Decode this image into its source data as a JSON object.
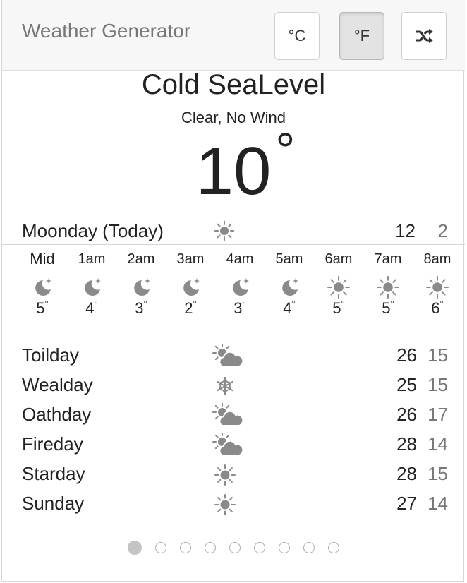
{
  "header": {
    "title": "Weather Generator",
    "celsius_label": "°C",
    "fahrenheit_label": "°F",
    "shuffle_icon": "shuffle-icon"
  },
  "current": {
    "location": "Cold SeaLevel",
    "conditions": "Clear, No Wind",
    "temperature": "10",
    "degree_symbol": "°"
  },
  "today": {
    "label": "Moonday (Today)",
    "icon": "sun-icon",
    "high": "12",
    "low": "2"
  },
  "hourly": [
    {
      "time": "Mid",
      "icon": "moon-icon",
      "temp": "5"
    },
    {
      "time": "1am",
      "icon": "moon-icon",
      "temp": "4"
    },
    {
      "time": "2am",
      "icon": "moon-icon",
      "temp": "3"
    },
    {
      "time": "3am",
      "icon": "moon-icon",
      "temp": "2"
    },
    {
      "time": "4am",
      "icon": "moon-icon",
      "temp": "3"
    },
    {
      "time": "5am",
      "icon": "moon-icon",
      "temp": "4"
    },
    {
      "time": "6am",
      "icon": "sun-icon",
      "temp": "5"
    },
    {
      "time": "7am",
      "icon": "sun-icon",
      "temp": "5"
    },
    {
      "time": "8am",
      "icon": "sun-icon",
      "temp": "6"
    }
  ],
  "daily": [
    {
      "day": "Toilday",
      "icon": "partly-cloudy-icon",
      "high": "26",
      "low": "15"
    },
    {
      "day": "Wealday",
      "icon": "snowflake-icon",
      "high": "25",
      "low": "15"
    },
    {
      "day": "Oathday",
      "icon": "partly-cloudy-icon",
      "high": "26",
      "low": "17"
    },
    {
      "day": "Fireday",
      "icon": "partly-cloudy-icon",
      "high": "28",
      "low": "14"
    },
    {
      "day": "Starday",
      "icon": "sun-icon",
      "high": "28",
      "low": "15"
    },
    {
      "day": "Sunday",
      "icon": "sun-icon",
      "high": "27",
      "low": "14"
    }
  ],
  "pagination": {
    "total_pages": 9,
    "active_page": 1
  },
  "colors": {
    "icon": "#8a8a8a",
    "text": "#222222",
    "muted": "#777777",
    "active_button_bg": "#e3e3e3"
  }
}
